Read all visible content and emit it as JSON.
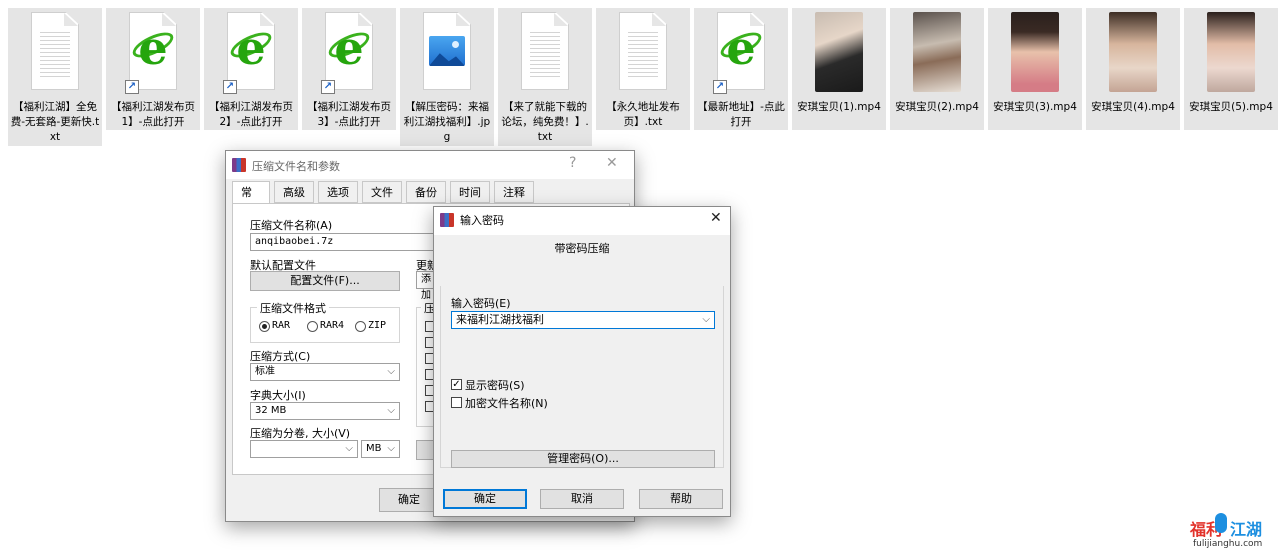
{
  "desktop_files": [
    {
      "name": "【福利江湖】全免费-无套路-更新快.txt",
      "type": "txt"
    },
    {
      "name": "【福利江湖发布页1】-点此打开",
      "type": "url"
    },
    {
      "name": "【福利江湖发布页2】-点此打开",
      "type": "url"
    },
    {
      "name": "【福利江湖发布页3】-点此打开",
      "type": "url"
    },
    {
      "name": "【解压密码：来福利江湖找福利】.jpg",
      "type": "jpg"
    },
    {
      "name": "【来了就能下载的论坛，纯免费！】.txt",
      "type": "txt"
    },
    {
      "name": "【永久地址发布页】.txt",
      "type": "txt"
    },
    {
      "name": "【最新地址】-点此打开",
      "type": "url"
    },
    {
      "name": "安琪宝贝(1).mp4",
      "type": "mp4"
    },
    {
      "name": "安琪宝贝(2).mp4",
      "type": "mp4"
    },
    {
      "name": "安琪宝贝(3).mp4",
      "type": "mp4"
    },
    {
      "name": "安琪宝贝(4).mp4",
      "type": "mp4"
    },
    {
      "name": "安琪宝贝(5).mp4",
      "type": "mp4"
    }
  ],
  "archive_dialog": {
    "title": "压缩文件名和参数",
    "help_glyph": "?",
    "close_glyph": "✕",
    "tabs": [
      "常规",
      "高级",
      "选项",
      "文件",
      "备份",
      "时间",
      "注释"
    ],
    "archive_name_label": "压缩文件名称(A)",
    "archive_name_value": "anqibaobei.7z",
    "default_profile_label": "默认配置文件",
    "profiles_button": "配置文件(F)...",
    "update_label_partial": "更新",
    "add_partial": "添加",
    "format_group_title": "压缩文件格式",
    "formats": [
      "RAR",
      "RAR4",
      "ZIP"
    ],
    "selected_format": "RAR",
    "options_group_title_partial": "压",
    "method_label": "压缩方式(C)",
    "method_value": "标准",
    "dict_label": "字典大小(I)",
    "dict_value": "32 MB",
    "split_label": "压缩为分卷, 大小(V)",
    "split_value": "",
    "split_unit": "MB",
    "ok_partial": "确定"
  },
  "password_dialog": {
    "title": "输入密码",
    "close_glyph": "✕",
    "heading": "带密码压缩",
    "password_label": "输入密码(E)",
    "password_value": "来福利江湖找福利",
    "show_password_label": "显示密码(S)",
    "show_password_checked": true,
    "encrypt_names_label": "加密文件名称(N)",
    "encrypt_names_checked": false,
    "manage_button": "管理密码(O)...",
    "ok_button": "确定",
    "cancel_button": "取消",
    "help_button": "帮助"
  },
  "watermark": {
    "logo_part1": "福利",
    "logo_part2": "江湖",
    "url": "fulijianghu.com",
    "color_red": "#e2322a",
    "color_blue": "#1d8fe0"
  }
}
